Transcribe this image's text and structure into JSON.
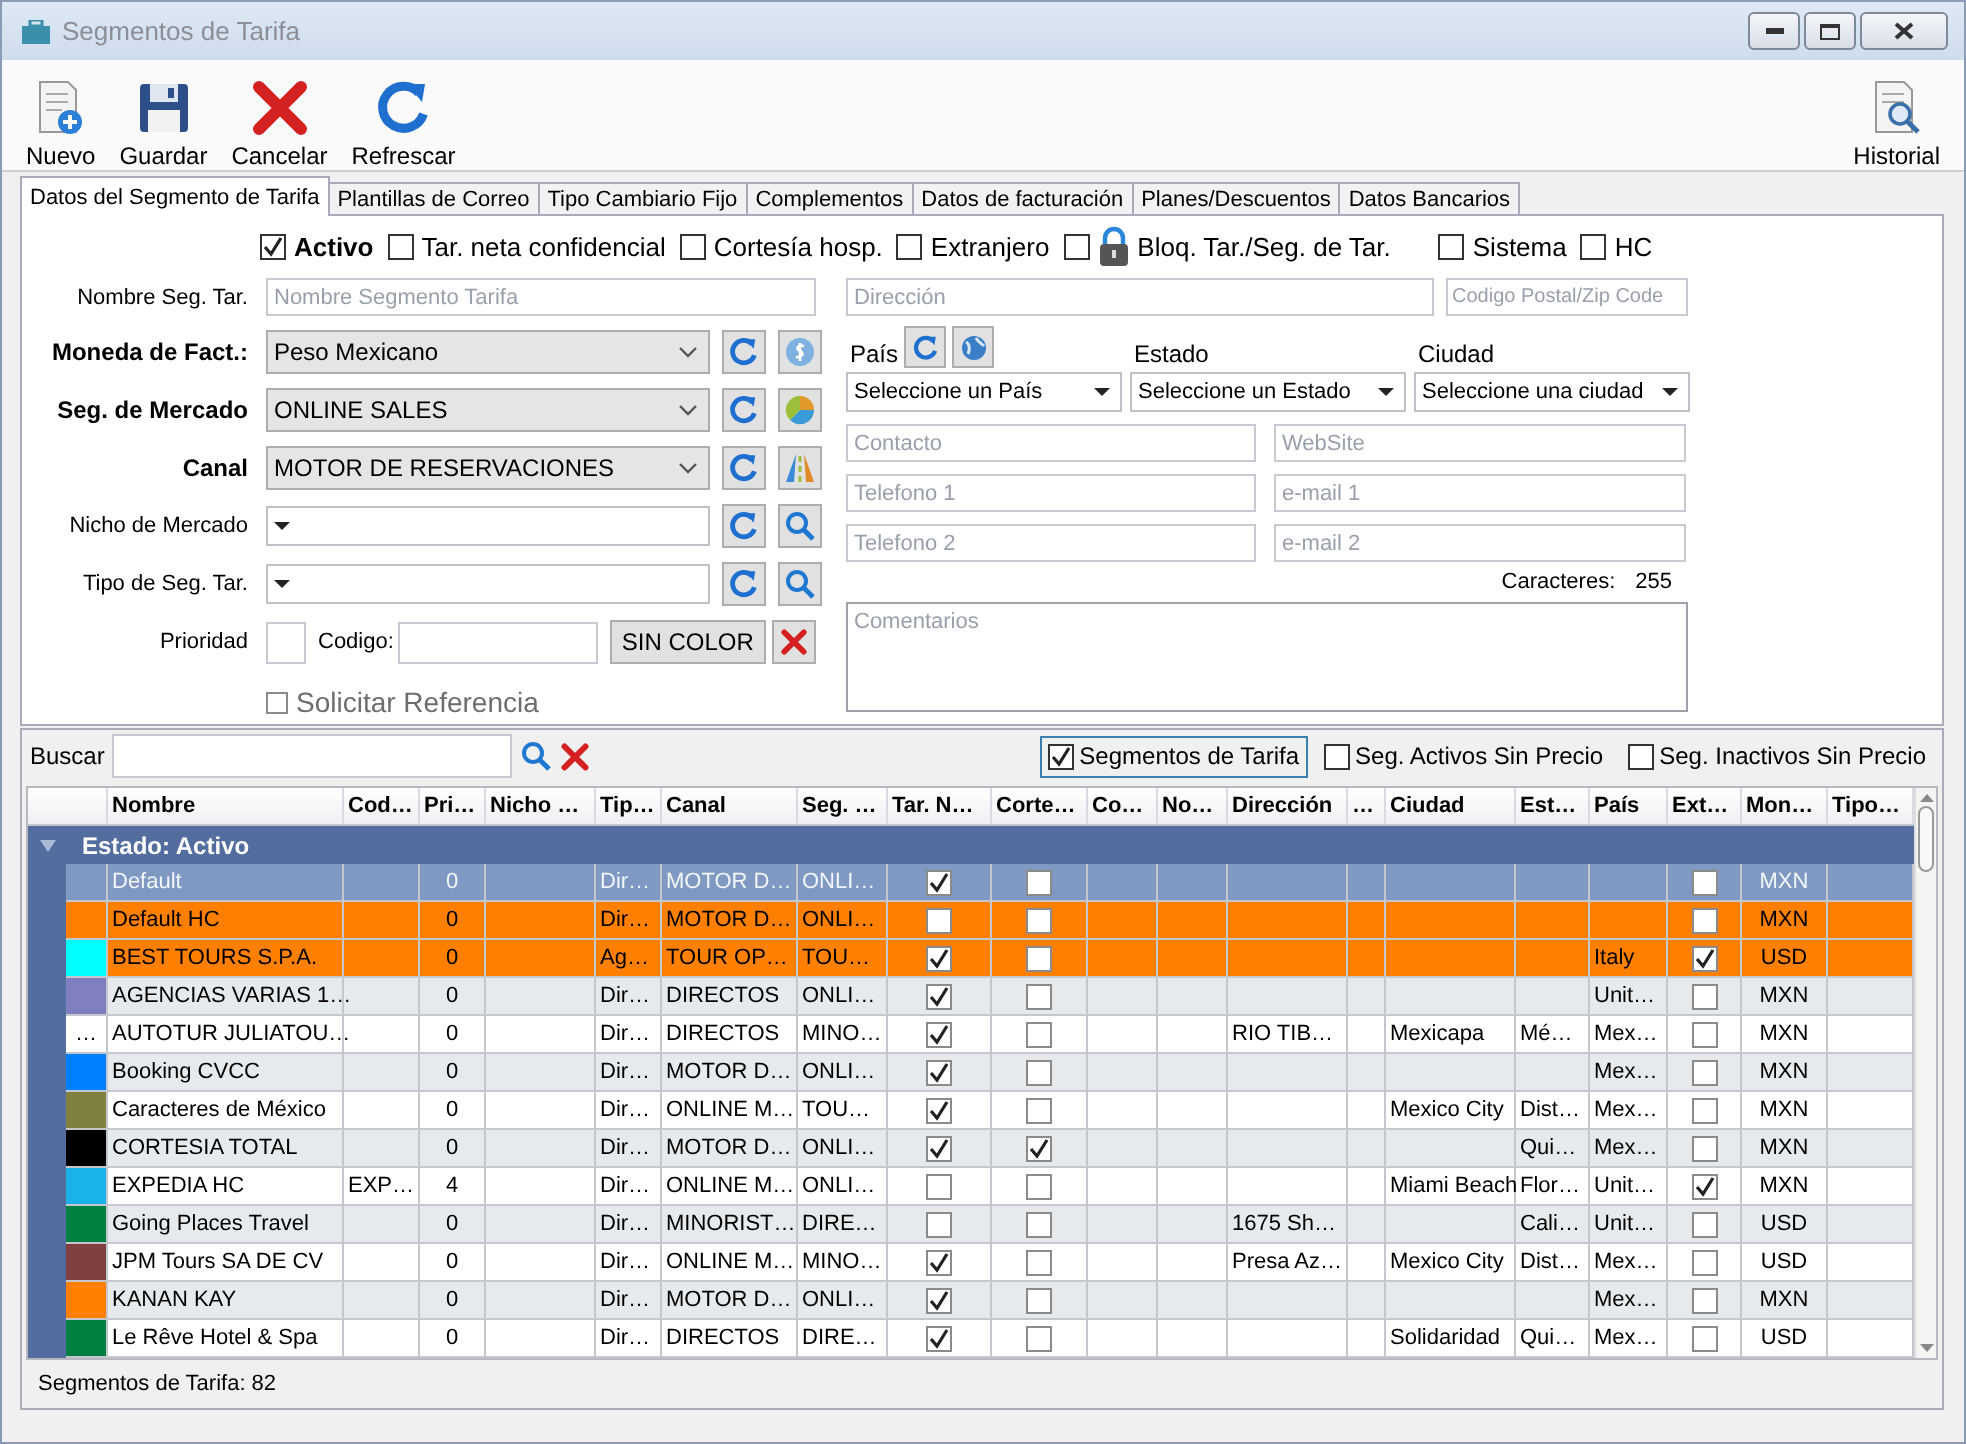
{
  "window": {
    "title": "Segmentos de Tarifa"
  },
  "toolbar": {
    "buttons": [
      {
        "label": "Nuevo",
        "kind": "new"
      },
      {
        "label": "Guardar",
        "kind": "save"
      },
      {
        "label": "Cancelar",
        "kind": "cancel"
      },
      {
        "label": "Refrescar",
        "kind": "refresh"
      }
    ],
    "history": {
      "label": "Historial"
    }
  },
  "tabs": [
    {
      "label": "Datos del Segmento de Tarifa",
      "selected": true
    },
    {
      "label": "Plantillas de Correo",
      "selected": false
    },
    {
      "label": "Tipo Cambiario Fijo",
      "selected": false
    },
    {
      "label": "Complementos",
      "selected": false
    },
    {
      "label": "Datos de facturación",
      "selected": false
    },
    {
      "label": "Planes/Descuentos",
      "selected": false
    },
    {
      "label": "Datos Bancarios",
      "selected": false
    }
  ],
  "flags": [
    {
      "label": "Activo",
      "checked": true,
      "kind": "primary"
    },
    {
      "label": "Tar. neta confidencial",
      "checked": false,
      "kind": "plain"
    },
    {
      "label": "Cortesía hosp.",
      "checked": false,
      "kind": "plain"
    },
    {
      "label": "Extranjero",
      "checked": false,
      "kind": "plain"
    },
    {
      "label": "Bloq. Tar./Seg. de Tar.",
      "checked": false,
      "kind": "locked"
    },
    {
      "label": "Sistema",
      "checked": false,
      "kind": "plain"
    },
    {
      "label": "HC",
      "checked": false,
      "kind": "plain"
    }
  ],
  "form_left": {
    "name": {
      "label": "Nombre Seg. Tar.",
      "placeholder": "Nombre Segmento Tarifa"
    },
    "selects": [
      {
        "label": "Moneda de Fact.:",
        "value": "Peso Mexicano",
        "kind": "required"
      },
      {
        "label": "Seg. de Mercado",
        "value": "ONLINE SALES",
        "kind": "required"
      },
      {
        "label": "Canal",
        "value": "MOTOR DE RESERVACIONES",
        "kind": "required"
      },
      {
        "label": "Nicho de Mercado",
        "kind": "optional"
      },
      {
        "label": "Tipo de Seg. Tar.",
        "kind": "optional"
      }
    ],
    "priority": {
      "label": "Prioridad"
    },
    "code": {
      "label": "Codigo:"
    },
    "color_button": "SIN COLOR",
    "request_reference": {
      "label": "Solicitar Referencia",
      "checked": false,
      "disabled": true
    }
  },
  "form_right": {
    "address": {
      "placeholder": "Dirección"
    },
    "zip": {
      "placeholder": "Codigo Postal/Zip Code"
    },
    "location": [
      {
        "label": "País",
        "value": "Seleccione un País"
      },
      {
        "label": "Estado",
        "value": "Seleccione un Estado"
      },
      {
        "label": "Ciudad",
        "value": "Seleccione una ciudad"
      }
    ],
    "contacts": [
      {
        "placeholder": "Contacto"
      },
      {
        "placeholder": "WebSite"
      },
      {
        "placeholder": "Telefono 1"
      },
      {
        "placeholder": "e-mail 1"
      },
      {
        "placeholder": "Telefono 2"
      },
      {
        "placeholder": "e-mail 2"
      }
    ],
    "characters": {
      "label": "Caracteres:",
      "count": "255"
    },
    "comments": {
      "placeholder": "Comentarios"
    }
  },
  "filter_bar": {
    "search_label": "Buscar",
    "filters": [
      {
        "label": "Segmentos de Tarifa",
        "checked": true
      },
      {
        "label": "Seg. Activos Sin Precio",
        "checked": false
      },
      {
        "label": "Seg. Inactivos Sin Precio",
        "checked": false
      }
    ]
  },
  "table": {
    "columns": [
      "Nombre",
      "Cod…",
      "Pri…",
      "Nicho …",
      "Tip…",
      "Canal",
      "Seg. …",
      "Tar. N…",
      "Corte…",
      "Co…",
      "No…",
      "Dirección",
      "…",
      "Ciudad",
      "Est…",
      "País",
      "Ext…",
      "Mon…",
      "Tipo…"
    ],
    "group": {
      "label": "Estado: Activo",
      "expanded": true
    },
    "rows": [
      {
        "name": "Default",
        "priority": "0",
        "type": "Dir…",
        "channel": "MOTOR D…",
        "segment": "ONLI…",
        "net": true,
        "courtesy": false,
        "foreign": false,
        "currency": "MXN",
        "selected": true,
        "flagged": false
      },
      {
        "color": "#ff8000",
        "name": "Default HC",
        "priority": "0",
        "type": "Dir…",
        "channel": "MOTOR D…",
        "segment": "ONLI…",
        "net": false,
        "courtesy": false,
        "foreign": false,
        "currency": "MXN",
        "selected": false,
        "flagged": true
      },
      {
        "color": "#00ffff",
        "name": "BEST TOURS S.P.A.",
        "priority": "0",
        "type": "Ag…",
        "channel": "TOUR OP…",
        "segment": "TOU…",
        "net": true,
        "courtesy": false,
        "country": "Italy",
        "foreign": true,
        "currency": "USD",
        "selected": false,
        "flagged": true
      },
      {
        "color": "#8080c0",
        "name": "AGENCIAS VARIAS 1…",
        "priority": "0",
        "type": "Dir…",
        "channel": "DIRECTOS",
        "segment": "ONLI…",
        "net": true,
        "courtesy": false,
        "country": "Unit…",
        "foreign": false,
        "currency": "MXN",
        "selected": false,
        "flagged": false
      },
      {
        "color": "#ffffff",
        "swatch_text": "…",
        "name": "AUTOTUR JULIATOU…",
        "priority": "0",
        "type": "Dir…",
        "channel": "DIRECTOS",
        "segment": "MINO…",
        "net": true,
        "courtesy": false,
        "address": "RIO TIB…",
        "city": "Mexicapa",
        "state": "Mé…",
        "country": "Mex…",
        "foreign": false,
        "currency": "MXN",
        "selected": false,
        "flagged": false
      },
      {
        "color": "#0080ff",
        "name": "Booking CVCC",
        "priority": "0",
        "type": "Dir…",
        "channel": "MOTOR D…",
        "segment": "ONLI…",
        "net": true,
        "courtesy": false,
        "country": "Mex…",
        "foreign": false,
        "currency": "MXN",
        "selected": false,
        "flagged": false
      },
      {
        "color": "#808040",
        "name": "Caracteres de México",
        "priority": "0",
        "type": "Dir…",
        "channel": "ONLINE M…",
        "segment": "TOU…",
        "net": true,
        "courtesy": false,
        "city": "Mexico City",
        "state": "Dist…",
        "country": "Mex…",
        "foreign": false,
        "currency": "MXN",
        "selected": false,
        "flagged": false
      },
      {
        "color": "#000000",
        "name": "CORTESIA TOTAL",
        "priority": "0",
        "type": "Dir…",
        "channel": "MOTOR D…",
        "segment": "ONLI…",
        "net": true,
        "courtesy": true,
        "state": "Qui…",
        "country": "Mex…",
        "foreign": false,
        "currency": "MXN",
        "selected": false,
        "flagged": false
      },
      {
        "color": "#1ab2e8",
        "name": "EXPEDIA HC",
        "code": "EXP…",
        "priority": "4",
        "type": "Dir…",
        "channel": "ONLINE M…",
        "segment": "ONLI…",
        "net": false,
        "courtesy": false,
        "city": "Miami Beach",
        "state": "Flor…",
        "country": "Unit…",
        "foreign": true,
        "currency": "MXN",
        "selected": false,
        "flagged": false
      },
      {
        "color": "#008040",
        "name": "Going Places Travel",
        "priority": "0",
        "type": "Dir…",
        "channel": "MINORIST…",
        "segment": "DIRE…",
        "net": false,
        "courtesy": false,
        "address": "1675 Sh…",
        "state": "Cali…",
        "country": "Unit…",
        "foreign": false,
        "currency": "USD",
        "selected": false,
        "flagged": false
      },
      {
        "color": "#804040",
        "name": "JPM Tours SA DE CV",
        "priority": "0",
        "type": "Dir…",
        "channel": "ONLINE M…",
        "segment": "MINO…",
        "net": true,
        "courtesy": false,
        "address": "Presa Az…",
        "city": "Mexico City",
        "state": "Dist…",
        "country": "Mex…",
        "foreign": false,
        "currency": "USD",
        "selected": false,
        "flagged": false
      },
      {
        "color": "#ff8000",
        "name": "KANAN KAY",
        "priority": "0",
        "type": "Dir…",
        "channel": "MOTOR D…",
        "segment": "ONLI…",
        "net": true,
        "courtesy": false,
        "country": "Mex…",
        "foreign": false,
        "currency": "MXN",
        "selected": false,
        "flagged": false
      },
      {
        "color": "#008040",
        "name": "Le Rêve Hotel & Spa",
        "priority": "0",
        "type": "Dir…",
        "channel": "DIRECTOS",
        "segment": "DIRE…",
        "net": true,
        "courtesy": false,
        "city": "Solidaridad",
        "state": "Qui…",
        "country": "Mex…",
        "foreign": false,
        "currency": "USD",
        "selected": false,
        "flagged": false
      }
    ]
  },
  "status_bar": "Segmentos de Tarifa: 82"
}
